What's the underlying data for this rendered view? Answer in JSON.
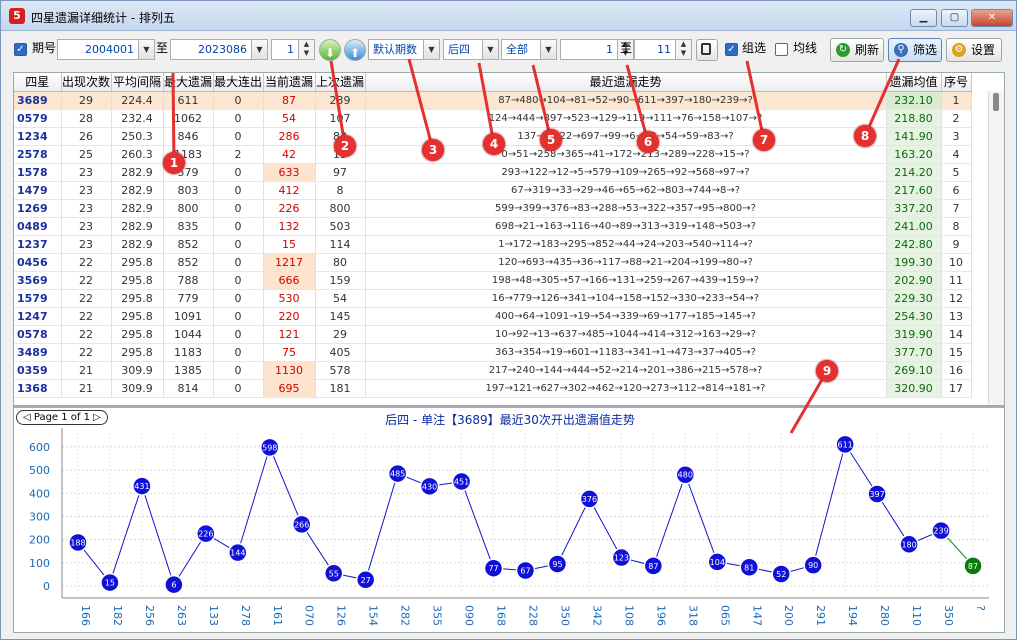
{
  "window": {
    "title": "四星遗漏详细统计 - 排列五",
    "icon_text": "5"
  },
  "toolbar": {
    "period_label": "期号",
    "from": "2004001",
    "to_label": "至",
    "to": "2023086",
    "count": "1",
    "mode": "默认期数",
    "pos": "后四",
    "scope": "全部",
    "num_from": "1",
    "num_to_label": "至",
    "num_to": "11",
    "group_label": "组选",
    "avg_label": "均线",
    "refresh": "刷新",
    "filter": "筛选",
    "settings": "设置"
  },
  "grid": {
    "headers": [
      "四星",
      "出现次数",
      "平均间隔",
      "最大遗漏",
      "最大连出",
      "当前遗漏",
      "上次遗漏",
      "最近遗漏走势",
      "遗漏均值",
      "序号"
    ],
    "rows": [
      {
        "num": "3689",
        "cnt": "29",
        "avg": "224.4",
        "max": "611",
        "cont": "0",
        "cur": "87",
        "last": "239",
        "trend": "87→480→104→81→52→90→611→397→180→239→?",
        "mean": "232.10",
        "idx": "1"
      },
      {
        "num": "0579",
        "cnt": "28",
        "avg": "232.4",
        "max": "1062",
        "cont": "0",
        "cur": "54",
        "last": "107",
        "trend": "124→444→897→523→129→119→111→76→158→107→?",
        "mean": "218.80",
        "idx": "2"
      },
      {
        "num": "1234",
        "cnt": "26",
        "avg": "250.3",
        "max": "846",
        "cont": "0",
        "cur": "286",
        "last": "83",
        "trend": "137→8→22→697→99→6→79→54→59→83→?",
        "mean": "141.90",
        "idx": "3"
      },
      {
        "num": "2578",
        "cnt": "25",
        "avg": "260.3",
        "max": "1183",
        "cont": "2",
        "cur": "42",
        "last": "15",
        "trend": "0→51→258→365→41→172→213→289→228→15→?",
        "mean": "163.20",
        "idx": "4"
      },
      {
        "num": "1578",
        "cnt": "23",
        "avg": "282.9",
        "max": "579",
        "cont": "0",
        "cur": "633",
        "last": "97",
        "trend": "293→122→12→5→579→109→265→92→568→97→?",
        "mean": "214.20",
        "idx": "5"
      },
      {
        "num": "1479",
        "cnt": "23",
        "avg": "282.9",
        "max": "803",
        "cont": "0",
        "cur": "412",
        "last": "8",
        "trend": "67→319→33→29→46→65→62→803→744→8→?",
        "mean": "217.60",
        "idx": "6"
      },
      {
        "num": "1269",
        "cnt": "23",
        "avg": "282.9",
        "max": "800",
        "cont": "0",
        "cur": "226",
        "last": "800",
        "trend": "599→399→376→83→288→53→322→357→95→800→?",
        "mean": "337.20",
        "idx": "7"
      },
      {
        "num": "0489",
        "cnt": "23",
        "avg": "282.9",
        "max": "835",
        "cont": "0",
        "cur": "132",
        "last": "503",
        "trend": "698→21→163→116→40→89→313→319→148→503→?",
        "mean": "241.00",
        "idx": "8"
      },
      {
        "num": "1237",
        "cnt": "23",
        "avg": "282.9",
        "max": "852",
        "cont": "0",
        "cur": "15",
        "last": "114",
        "trend": "1→172→183→295→852→44→24→203→540→114→?",
        "mean": "242.80",
        "idx": "9"
      },
      {
        "num": "0456",
        "cnt": "22",
        "avg": "295.8",
        "max": "852",
        "cont": "0",
        "cur": "1217",
        "last": "80",
        "trend": "120→693→435→36→117→88→21→204→199→80→?",
        "mean": "199.30",
        "idx": "10"
      },
      {
        "num": "3569",
        "cnt": "22",
        "avg": "295.8",
        "max": "788",
        "cont": "0",
        "cur": "666",
        "last": "159",
        "trend": "198→48→305→57→166→131→259→267→439→159→?",
        "mean": "202.90",
        "idx": "11"
      },
      {
        "num": "1579",
        "cnt": "22",
        "avg": "295.8",
        "max": "779",
        "cont": "0",
        "cur": "530",
        "last": "54",
        "trend": "16→779→126→341→104→158→152→330→233→54→?",
        "mean": "229.30",
        "idx": "12"
      },
      {
        "num": "1247",
        "cnt": "22",
        "avg": "295.8",
        "max": "1091",
        "cont": "0",
        "cur": "220",
        "last": "145",
        "trend": "400→64→1091→19→54→339→69→177→185→145→?",
        "mean": "254.30",
        "idx": "13"
      },
      {
        "num": "0578",
        "cnt": "22",
        "avg": "295.8",
        "max": "1044",
        "cont": "0",
        "cur": "121",
        "last": "29",
        "trend": "10→92→13→637→485→1044→414→312→163→29→?",
        "mean": "319.90",
        "idx": "14"
      },
      {
        "num": "3489",
        "cnt": "22",
        "avg": "295.8",
        "max": "1183",
        "cont": "0",
        "cur": "75",
        "last": "405",
        "trend": "363→354→19→601→1183→341→1→473→37→405→?",
        "mean": "377.70",
        "idx": "15"
      },
      {
        "num": "0359",
        "cnt": "21",
        "avg": "309.9",
        "max": "1385",
        "cont": "0",
        "cur": "1130",
        "last": "578",
        "trend": "217→240→144→444→52→214→201→386→215→578→?",
        "mean": "269.10",
        "idx": "16"
      },
      {
        "num": "1368",
        "cnt": "21",
        "avg": "309.9",
        "max": "814",
        "cont": "0",
        "cur": "695",
        "last": "181",
        "trend": "197→121→627→302→462→120→273→112→814→181→?",
        "mean": "320.90",
        "idx": "17"
      }
    ]
  },
  "chart": {
    "pager": "Page 1 of 1"
  },
  "chart_data": {
    "type": "line",
    "title": "后四 - 单注【3689】最近30次开出遗漏值走势",
    "x": [
      "166",
      "182",
      "256",
      "263",
      "133",
      "278",
      "161",
      "070",
      "126",
      "154",
      "282",
      "355",
      "090",
      "168",
      "228",
      "350",
      "342",
      "108",
      "196",
      "318",
      "065",
      "147",
      "200",
      "291",
      "194",
      "280",
      "110",
      "350",
      "?"
    ],
    "values": [
      188,
      15,
      431,
      6,
      226,
      144,
      598,
      266,
      55,
      27,
      485,
      430,
      451,
      77,
      67,
      95,
      376,
      123,
      87,
      480,
      104,
      81,
      52,
      90,
      611,
      397,
      180,
      239,
      87
    ],
    "yticks": [
      0,
      100,
      200,
      300,
      400,
      500,
      600
    ],
    "ylim": [
      -30,
      660
    ],
    "grid": true,
    "colors": {
      "line": "#1414c8",
      "point": "#1010d8",
      "last_line": "#1a8a1a",
      "last_point": "#0a7a0a"
    }
  },
  "annotations": [
    "1",
    "2",
    "3",
    "4",
    "5",
    "6",
    "7",
    "8",
    "9"
  ]
}
